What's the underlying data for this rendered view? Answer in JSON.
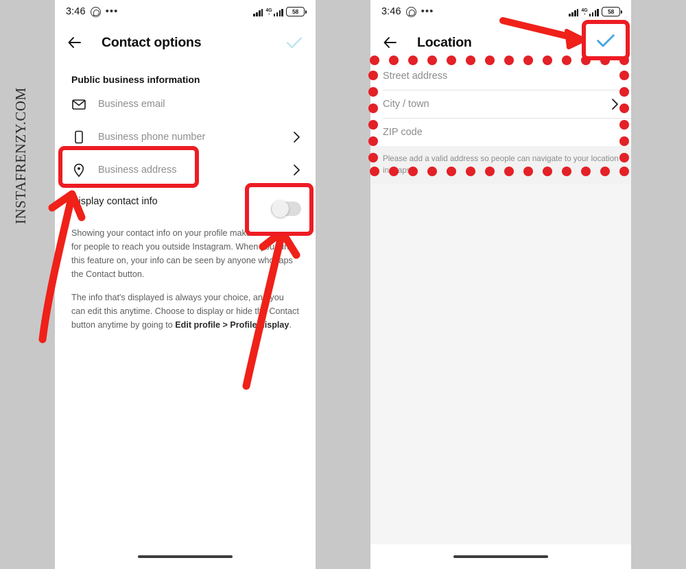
{
  "watermark": {
    "text": "INSTAFRENZY.COM"
  },
  "left_phone": {
    "statusbar": {
      "time": "3:46",
      "whatsapp_icon": "whatsapp-icon",
      "overflow_icon": "more-dots-icon",
      "network_type": "4G",
      "network_sub": "+",
      "battery_level": "58"
    },
    "appbar": {
      "back_icon": "back-arrow-icon",
      "title": "Contact options",
      "confirm_icon": "checkmark-icon",
      "confirm_color": "#bfe4ee"
    },
    "section_heading": "Public business information",
    "rows": [
      {
        "icon": "envelope-icon",
        "label": "Business email",
        "chevron": false
      },
      {
        "icon": "phone-icon",
        "label": "Business phone number",
        "chevron": true
      },
      {
        "icon": "location-pin-icon",
        "label": "Business address",
        "chevron": true
      }
    ],
    "toggle_row": {
      "label": "Display contact info",
      "state": "off"
    },
    "paragraphs": [
      {
        "plain_before": "Showing your contact info on your profile makes it easier for people to reach you outside Instagram. When you turn this feature on, your info can be seen by anyone who taps the Contact button.",
        "bold": "",
        "plain_after": ""
      },
      {
        "plain_before": "The info that's displayed is always your choice, and you can edit this anytime. Choose to display or hide the Contact button anytime by going to ",
        "bold": "Edit profile > Profile display",
        "plain_after": "."
      }
    ]
  },
  "right_phone": {
    "statusbar": {
      "time": "3:46",
      "whatsapp_icon": "whatsapp-icon",
      "overflow_icon": "more-dots-icon",
      "network_type": "4G",
      "network_sub": "+",
      "battery_level": "58"
    },
    "appbar": {
      "back_icon": "back-arrow-icon",
      "title": "Location",
      "confirm_icon": "checkmark-icon",
      "confirm_color": "#4aa7e0"
    },
    "fields": [
      {
        "placeholder": "Street address",
        "value": "",
        "chevron": false
      },
      {
        "placeholder": "City / town",
        "value": "",
        "chevron": true
      },
      {
        "placeholder": "ZIP code",
        "value": "",
        "chevron": false
      }
    ],
    "helper_text": "Please add a valid address so people can navigate to your location in maps."
  },
  "annotations": {
    "color": "#ed1c24",
    "box_business_address": "highlight-box-business-address",
    "box_toggle": "highlight-box-display-toggle",
    "box_confirm": "highlight-box-confirm-check",
    "dotted_frame": "dotted-highlight-address-form",
    "arrow_to_address": "arrow-pointing-business-address",
    "arrow_to_toggle": "arrow-pointing-toggle",
    "arrow_to_confirm": "arrow-pointing-confirm-check"
  }
}
